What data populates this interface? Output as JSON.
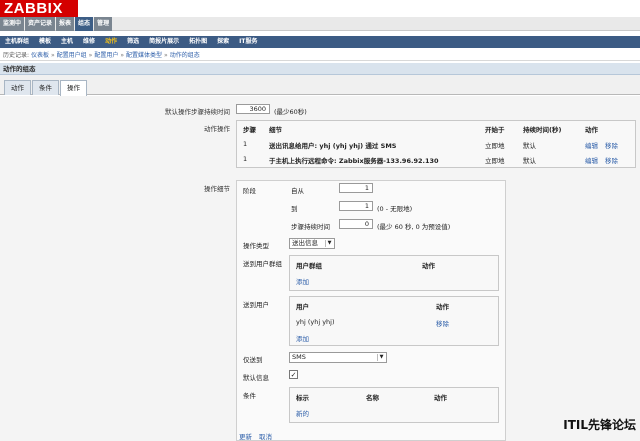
{
  "logo": "ZABBIX",
  "top_menu": [
    "监测中",
    "资产记录",
    "报表",
    "组态",
    "管理"
  ],
  "top_menu_active": 3,
  "sub_menu": [
    "主机群组",
    "模板",
    "主机",
    "维修",
    "动作",
    "筛选",
    "简报片展示",
    "拓扑图",
    "探索",
    "IT服务"
  ],
  "sub_menu_active": 4,
  "breadcrumb": {
    "prefix": "历史记录:",
    "items": [
      "仪表板",
      "配置用户组",
      "配置用户",
      "配置媒体类型",
      "动作的组态"
    ],
    "sep": "»"
  },
  "title": "动作的组态",
  "tabs": [
    "动作",
    "条件",
    "操作"
  ],
  "active_tab": 2,
  "default_duration": {
    "label": "默认操作步骤持续时间",
    "value": "3600",
    "hint": "(最少60秒)"
  },
  "operations": {
    "label": "动作操作",
    "headers": [
      "步骤",
      "细节",
      "开始于",
      "持续时间(秒)",
      "动作"
    ],
    "rows": [
      {
        "step": "1",
        "detail": "送出讯息给用户: yhj (yhj yhj) 通过 SMS",
        "start": "立即地",
        "duration": "默认",
        "edit": "编辑",
        "remove": "移除"
      },
      {
        "step": "1",
        "detail": "于主机上执行远程命令: Zabbix服务器-133.96.92.130",
        "start": "立即地",
        "duration": "默认",
        "edit": "编辑",
        "remove": "移除"
      }
    ]
  },
  "op_details": {
    "label": "操作细节",
    "stage_label": "阶段",
    "from_label": "自从",
    "from_value": "1",
    "to_label": "到",
    "to_value": "1",
    "to_hint": "(0 - 无限地)",
    "step_duration_label": "步骤持续时间",
    "step_duration_value": "0",
    "step_duration_hint": "(最少 60 秒, 0 为预设值)",
    "op_type_label": "操作类型",
    "op_type_value": "送出信息",
    "send_groups_label": "送到用户群组",
    "groups_headers": [
      "用户群组",
      "动作"
    ],
    "groups_add": "添加",
    "send_users_label": "送到用户",
    "users_headers": [
      "用户",
      "动作"
    ],
    "users_row": {
      "name": "yhj (yhj yhj)",
      "action": "移除"
    },
    "users_add": "添加",
    "only_send_label": "仅送到",
    "only_send_value": "SMS",
    "default_msg_label": "默认信息",
    "default_msg_checked": "✓",
    "conditions_label": "条件",
    "conditions_headers": [
      "标示",
      "名称",
      "动作"
    ],
    "conditions_new": "新的",
    "update": "更新",
    "cancel": "取消"
  },
  "watermark": "ITIL先锋论坛"
}
